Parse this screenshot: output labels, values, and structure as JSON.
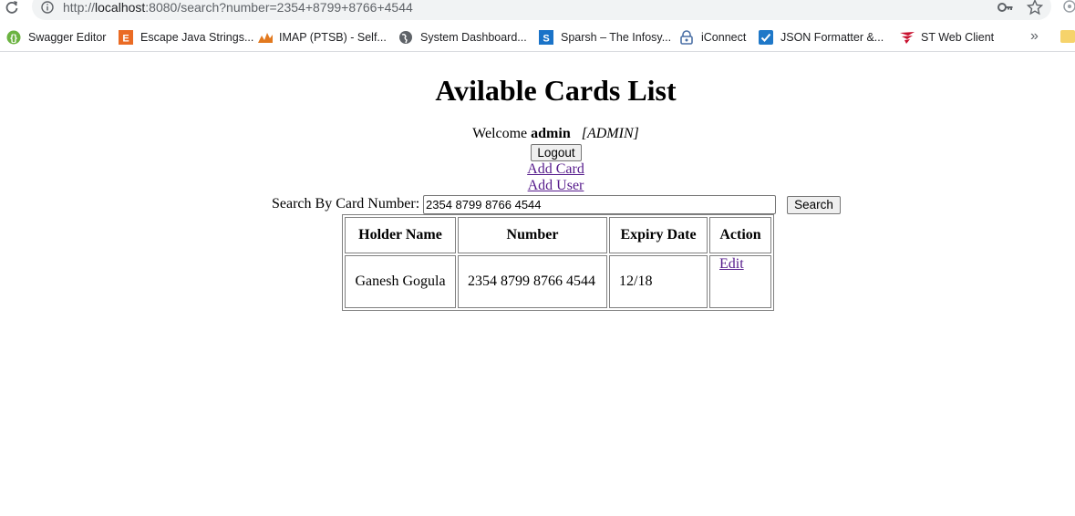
{
  "browser": {
    "url_prefix": "http://",
    "url_host": "localhost",
    "url_rest": ":8080/search?number=2354+8799+8766+4544"
  },
  "bookmarks": [
    {
      "label": "Swagger Editor",
      "icon": "swagger-icon",
      "color": "#6bb341"
    },
    {
      "label": "Escape Java Strings...",
      "icon": "escape-e-icon",
      "color": "#ea6b24"
    },
    {
      "label": "IMAP (PTSB) - Self...",
      "icon": "imap-icon",
      "color": "#e2791f"
    },
    {
      "label": "System Dashboard...",
      "icon": "globe-icon",
      "color": "#5f6368"
    },
    {
      "label": "Sparsh – The Infosy...",
      "icon": "sparsh-s-icon",
      "color": "#1a73c8"
    },
    {
      "label": "iConnect",
      "icon": "iconnect-lock-icon",
      "color": "#4a6fa5"
    },
    {
      "label": "JSON Formatter &...",
      "icon": "json-check-icon",
      "color": "#1f78c8"
    },
    {
      "label": "ST Web Client",
      "icon": "st-wing-icon",
      "color": "#c8102e"
    }
  ],
  "page": {
    "title": "Avilable Cards List",
    "welcome_prefix": "Welcome ",
    "username": "admin",
    "role": "[ADMIN]",
    "logout_label": "Logout",
    "add_card_label": "Add Card",
    "add_user_label": "Add User",
    "search_label": "Search By Card Number:",
    "search_value": "2354 8799 8766 4544",
    "search_button": "Search"
  },
  "table": {
    "headers": [
      "Holder Name",
      "Number",
      "Expiry Date",
      "Action"
    ],
    "rows": [
      {
        "holder": "Ganesh Gogula",
        "number": "2354 8799 8766 4544",
        "expiry": "12/18",
        "action": "Edit"
      }
    ]
  }
}
